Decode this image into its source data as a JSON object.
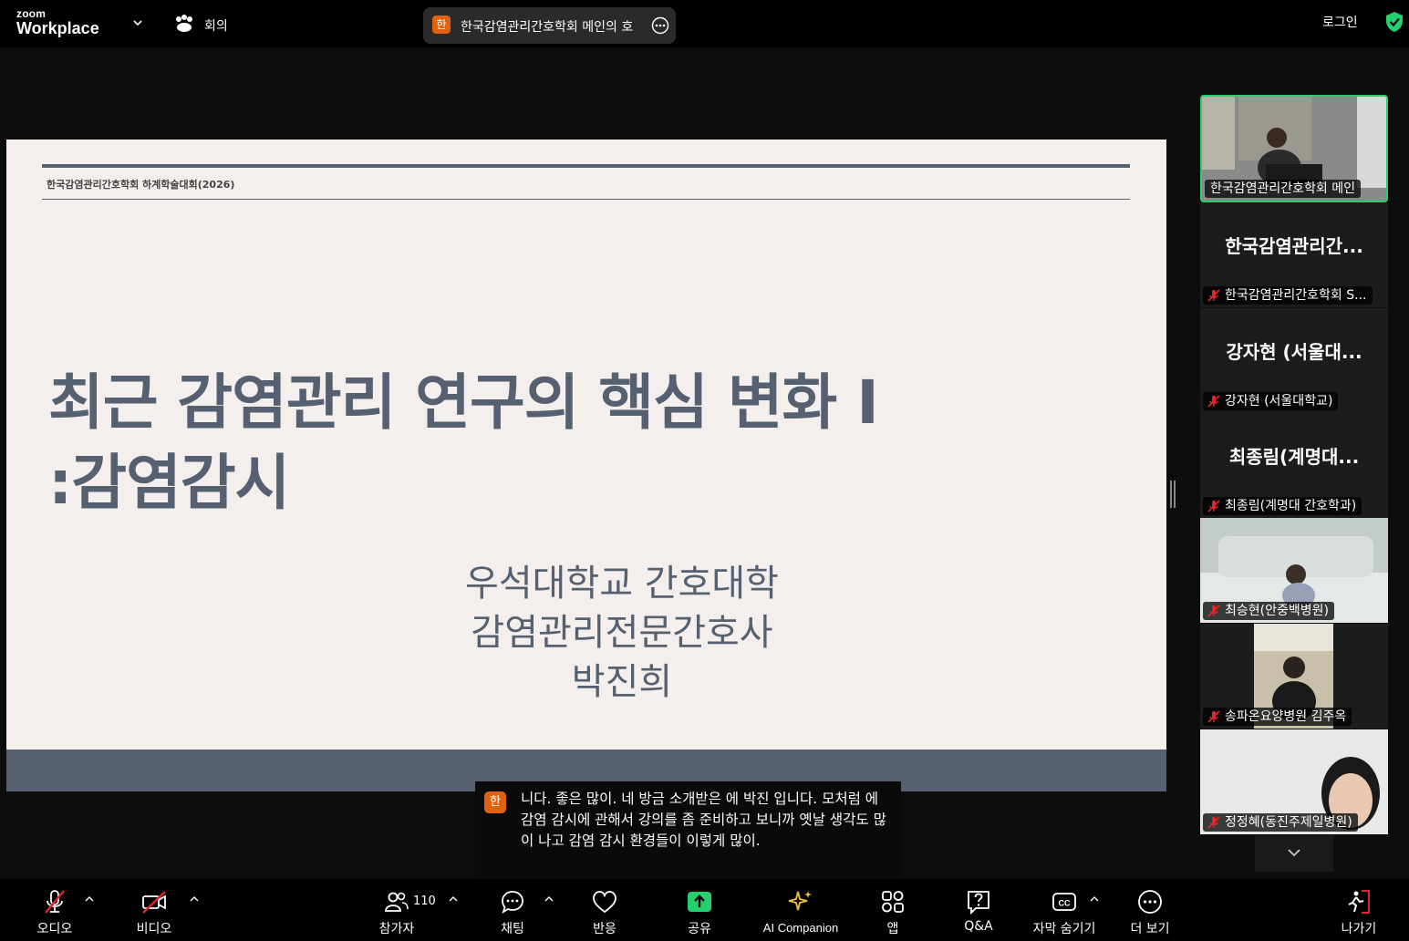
{
  "topbar": {
    "logo_line1": "zoom",
    "logo_line2": "Workplace",
    "meetings_label": "회의",
    "meeting_avatar": "한",
    "meeting_title": "한국감염관리간호학회 메인의 호",
    "login_label": "로그인",
    "icons": [
      "chevron-down-icon",
      "meetings-paw-icon",
      "more-icon",
      "shield-check-icon"
    ]
  },
  "slide": {
    "header": "한국감염관리간호학회 하계학술대회(2026)",
    "title_line1": "최근 감염관리 연구의 핵심 변화 I",
    "title_line2": ":감염감시",
    "author_line1": "우석대학교 간호대학",
    "author_line2": "감염관리전문간호사",
    "author_line3": "박진희",
    "background_color": "#f4eeed",
    "accent_color": "#556070"
  },
  "caption": {
    "avatar": "한",
    "text": "니다. 좋은 많이. 네 방금 소개받은 에 박진 입니다. 모처럼 에 감염 감시에 관해서 강의를 좀 준비하고 보니까 옛날 생각도 많이 나고 감염 감시 환경들이 이렇게 많이."
  },
  "participants": [
    {
      "name": "한국감염관리간호학회 메인",
      "video": true,
      "active_speaker": true
    },
    {
      "display": "한국감염관리간...",
      "name": "한국감염관리간호학회 S...",
      "video": false,
      "muted": true
    },
    {
      "display": "강자현 (서울대...",
      "name": "강자현 (서울대학교)",
      "video": false,
      "muted": true
    },
    {
      "display": "최종림(계명대...",
      "name": "최종림(계명대 간호학과)",
      "video": false,
      "muted": true
    },
    {
      "name": "최승현(안중백병원)",
      "video": true,
      "muted": true
    },
    {
      "name": "송파온요양병원 김주옥",
      "video": true,
      "muted": true
    },
    {
      "name": "정정혜(동진주제일병원)",
      "video": true,
      "muted": true
    }
  ],
  "toolbar": {
    "audio": "오디오",
    "video": "비디오",
    "participants": "참가자",
    "participants_count": "110",
    "chat": "채팅",
    "reactions": "반응",
    "share": "공유",
    "ai_companion": "AI Companion",
    "apps": "앱",
    "qa": "Q&A",
    "captions": "자막 숨기기",
    "more": "더 보기",
    "leave": "나가기",
    "colors": {
      "share": "#24d06d",
      "muted": "#e02828",
      "ai": "#f0c040",
      "leave": "#e02828"
    }
  }
}
